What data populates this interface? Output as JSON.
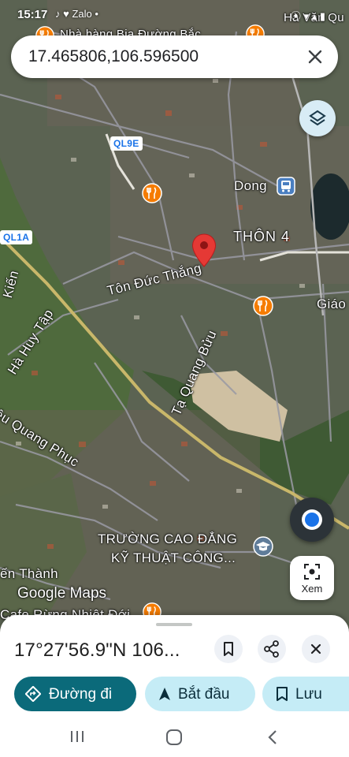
{
  "status_bar": {
    "time": "15:17",
    "left_icons": "♪ ♥ Zalo •",
    "right_icons": "⦿ ▾ ▴ ▮"
  },
  "search": {
    "query": "17.465806,106.596500",
    "clear_icon": "close-icon"
  },
  "map": {
    "labels": {
      "top_poi": "Nhà hàng Bia Đường Bắc",
      "top_right": "Hà Văn Qu",
      "road_ql9e": "QL9E",
      "road_ql1a": "QL1A",
      "dong": "Dong",
      "thon4": "THÔN 4",
      "ton_duc_thang": "Tôn Đức Thắng",
      "giao": "Giáo",
      "kien": "Kiến",
      "ha_huy_tap": "Hà Huy Tập",
      "ta_quang_buu": "Tạ Quang Bửu",
      "quang_phuc": "ệu Quang Phục",
      "truong_cd_1": "TRƯỜNG CAO ĐẲNG",
      "truong_cd_2": "KỸ THUẬT CÔNG...",
      "hien_thanh": "ến Thành",
      "cafe": "Cafe Rừng Nhiệt Đới"
    },
    "pin_color": "#e53935",
    "poi_color": "#f57c00",
    "google_logo": "Google Maps",
    "xem_label": "Xem"
  },
  "sheet": {
    "coords_text": "17°27'56.9\"N 106...",
    "bookmark_icon": "bookmark-icon",
    "share_icon": "share-icon",
    "close_icon": "close-icon",
    "buttons": {
      "directions": "Đường đi",
      "start": "Bắt đầu",
      "save": "Lưu"
    },
    "accent": "#0b6a7a"
  }
}
